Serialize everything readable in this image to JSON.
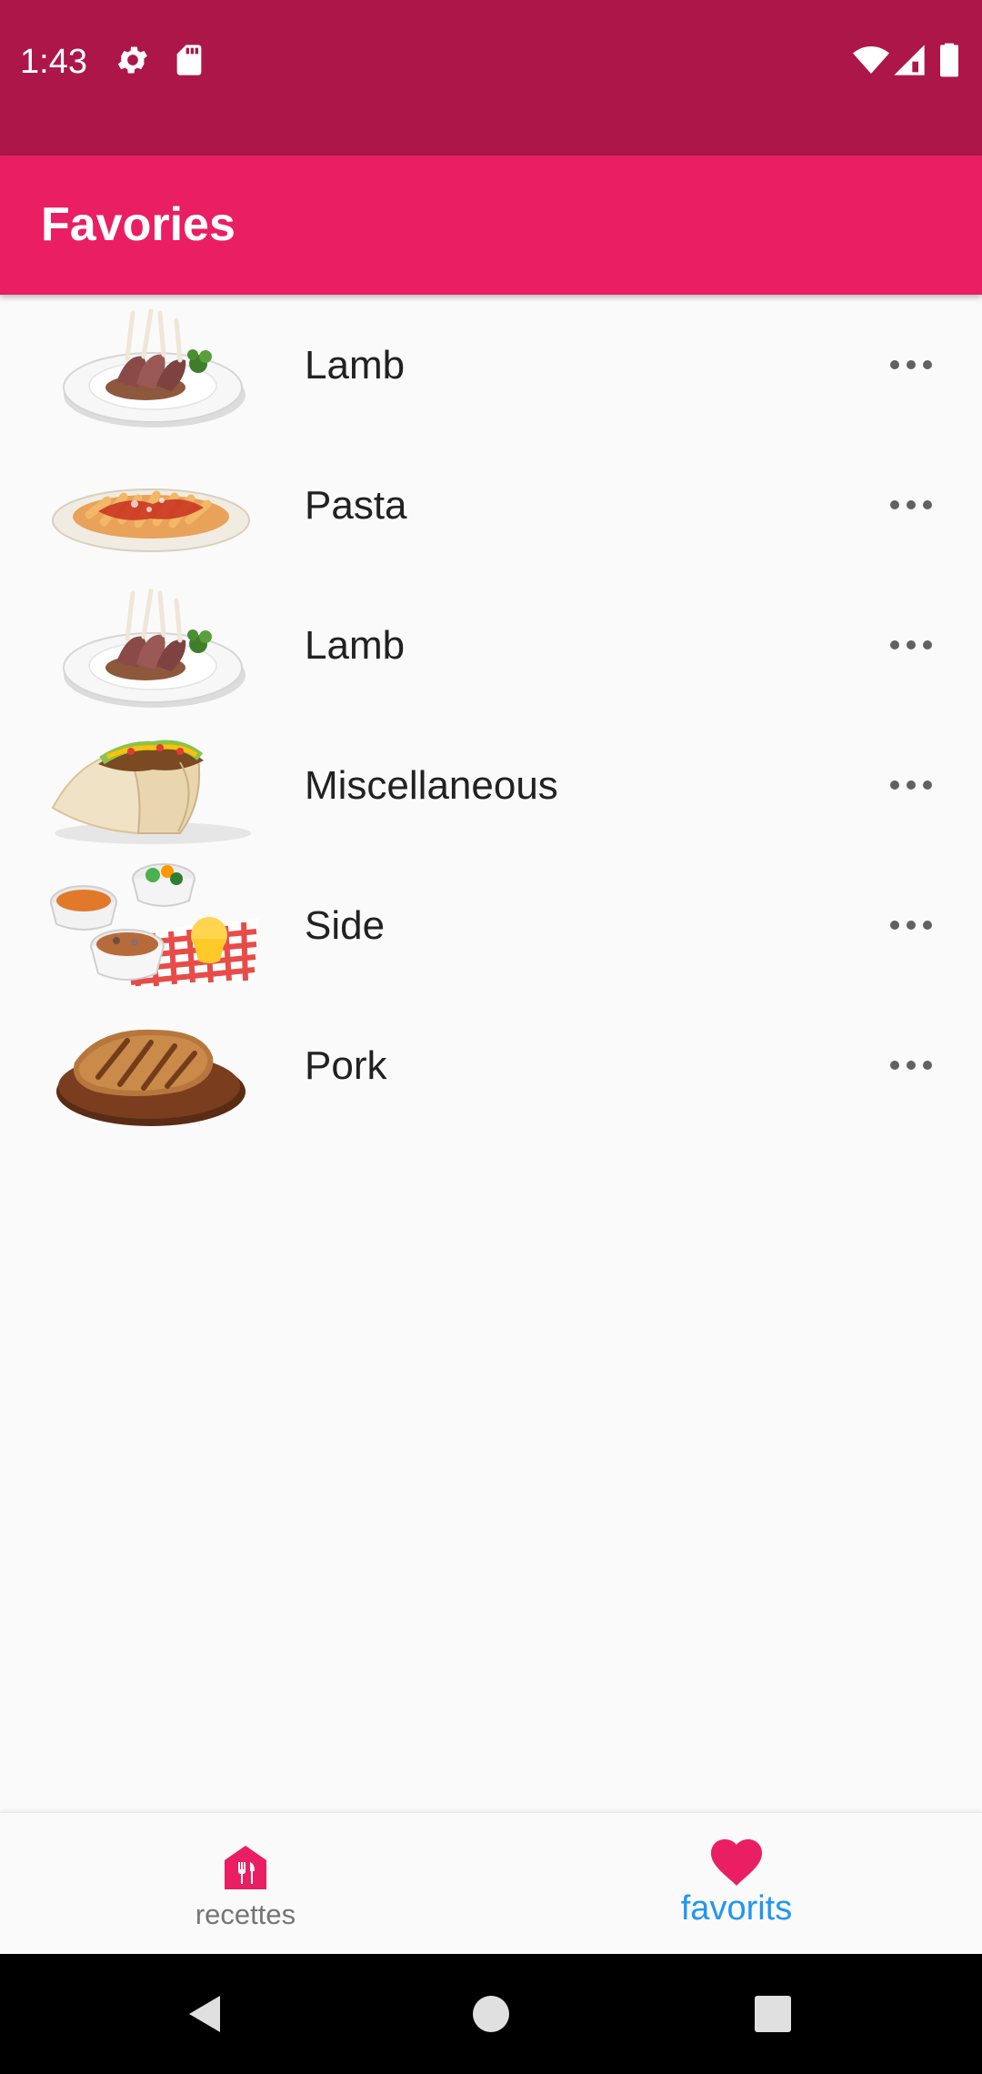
{
  "status_bar": {
    "time": "1:43",
    "icons": [
      "settings-icon",
      "sd-card-icon",
      "wifi-icon",
      "cell-signal-icon",
      "battery-icon"
    ]
  },
  "app_bar": {
    "title": "Favories"
  },
  "favorites": [
    {
      "label": "Lamb",
      "image": "lamb-dish-image",
      "menu": "more-options-icon"
    },
    {
      "label": "Pasta",
      "image": "pasta-dish-image",
      "menu": "more-options-icon"
    },
    {
      "label": "Lamb",
      "image": "lamb-dish-image",
      "menu": "more-options-icon"
    },
    {
      "label": "Miscellaneous",
      "image": "tacos-image",
      "menu": "more-options-icon"
    },
    {
      "label": "Side",
      "image": "side-dishes-image",
      "menu": "more-options-icon"
    },
    {
      "label": "Pork",
      "image": "pork-steak-image",
      "menu": "more-options-icon"
    }
  ],
  "bottom_nav": {
    "items": [
      {
        "label": "recettes",
        "icon": "restaurant-home-icon",
        "active": false
      },
      {
        "label": "favorits",
        "icon": "heart-icon",
        "active": true
      }
    ]
  },
  "colors": {
    "status_bar": "#ad1649",
    "app_bar": "#e91e63",
    "accent": "#e91e63",
    "active_nav_label": "#2196f3",
    "inactive_nav_label": "#757575"
  },
  "system_nav": {
    "buttons": [
      "back-icon",
      "home-icon",
      "recents-icon"
    ]
  }
}
